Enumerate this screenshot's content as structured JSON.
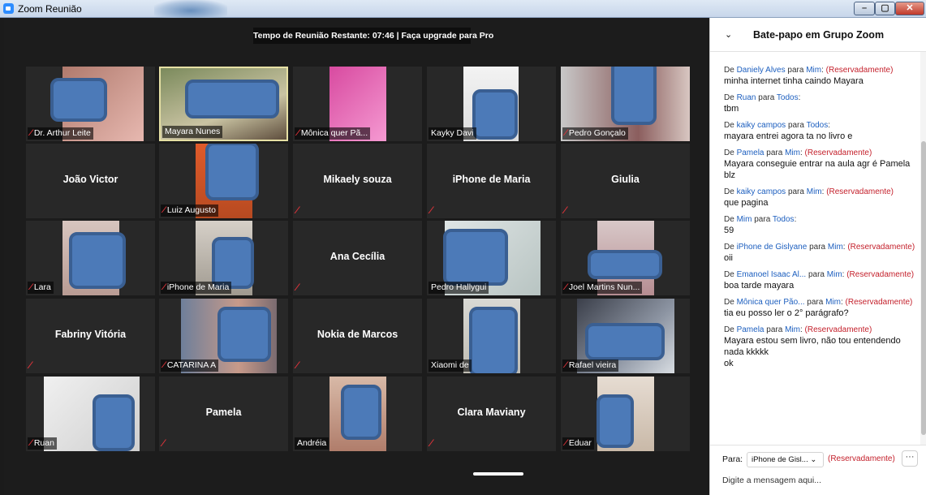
{
  "window": {
    "title": "Zoom Reunião",
    "min_label": "–",
    "max_label": "▢",
    "close_label": "✕"
  },
  "timer_banner": "Tempo de Reunião Restante: 07:46 | Faça upgrade para Pro",
  "participants": [
    {
      "name": "Dr. Arthur Leite",
      "type": "video",
      "muted": true
    },
    {
      "name": "Mayara Nunes",
      "type": "video",
      "muted": false,
      "active_speaker": true
    },
    {
      "name": "Mônica quer Pã...",
      "type": "video",
      "muted": true
    },
    {
      "name": "Kayky Davi",
      "type": "video",
      "muted": false
    },
    {
      "name": "Pedro Gonçalo",
      "type": "video",
      "muted": true
    },
    {
      "name": "João Victor",
      "type": "name",
      "muted": false
    },
    {
      "name": "Luiz Augusto",
      "type": "video",
      "muted": true
    },
    {
      "name": "Mikaely souza",
      "type": "name",
      "muted": true
    },
    {
      "name": "iPhone de Maria",
      "type": "name",
      "muted": true
    },
    {
      "name": "Giulia",
      "type": "name",
      "muted": true
    },
    {
      "name": "Lara",
      "type": "video",
      "muted": true
    },
    {
      "name": "iPhone de Maria",
      "type": "video",
      "muted": true
    },
    {
      "name": "Ana Cecília",
      "type": "name",
      "muted": true
    },
    {
      "name": "Pedro Hallygui",
      "type": "video",
      "muted": false
    },
    {
      "name": "Joel Martins Nun...",
      "type": "video",
      "muted": true
    },
    {
      "name": "Fabriny Vitória",
      "type": "name",
      "muted": true
    },
    {
      "name": "CATARINA A",
      "type": "video",
      "muted": true
    },
    {
      "name": "Nokia de Marcos",
      "type": "name",
      "muted": true
    },
    {
      "name": "Xiaomi de",
      "type": "video",
      "muted": false
    },
    {
      "name": "Rafael vieira",
      "type": "video",
      "muted": true
    },
    {
      "name": "Ruan",
      "type": "video",
      "muted": true
    },
    {
      "name": "Pamela",
      "type": "name",
      "muted": true
    },
    {
      "name": "Andréia",
      "type": "video",
      "muted": false
    },
    {
      "name": "Clara Maviany",
      "type": "name",
      "muted": true
    },
    {
      "name": "Eduar",
      "type": "video",
      "muted": true
    }
  ],
  "chat": {
    "title": "Bate-papo em Grupo Zoom",
    "messages": [
      {
        "from": "Daniely Alves",
        "to": "Mim",
        "private": true,
        "text": "minha internet tinha caindo Mayara"
      },
      {
        "from": "Ruan",
        "to": "Todos",
        "private": false,
        "text": "tbm"
      },
      {
        "from": "kaiky campos",
        "to": "Todos",
        "private": false,
        "text": "mayara entrei agora ta no livro e"
      },
      {
        "from": "Pamela",
        "to": "Mim",
        "private": true,
        "text": "Mayara conseguie entrar na aula agr é Pamela blz"
      },
      {
        "from": "kaiky campos",
        "to": "Mim",
        "private": true,
        "text": "que pagina"
      },
      {
        "from": "Mim",
        "to": "Todos",
        "private": false,
        "text": "59"
      },
      {
        "from": "iPhone de Gislyane",
        "to": "Mim",
        "private": true,
        "text": "oii"
      },
      {
        "from": "Emanoel Isaac Al...",
        "to": "Mim",
        "private": true,
        "text": "boa tarde mayara"
      },
      {
        "from": "Mônica quer Pão...",
        "to": "Mim",
        "private": true,
        "text": "tia eu posso ler o 2° parágrafo?"
      },
      {
        "from": "Pamela",
        "to": "Mim",
        "private": true,
        "text": "Mayara estou sem livro, não tou entendendo nada kkkkk\nok"
      }
    ],
    "words": {
      "de": "De",
      "para": "para",
      "private_tag": "(Reservadamente)"
    },
    "footer": {
      "to_label": "Para:",
      "recipient": "iPhone de Gisl...",
      "privacy": "(Reservadamente)",
      "more_label": "···",
      "input_placeholder": "Digite a mensagem aqui..."
    }
  },
  "colors": {
    "muted_icon": "#e0333a",
    "chat_sender": "#1d5fbf",
    "chat_private": "#c4212c",
    "active_speaker_border": "#e6e0a4"
  }
}
